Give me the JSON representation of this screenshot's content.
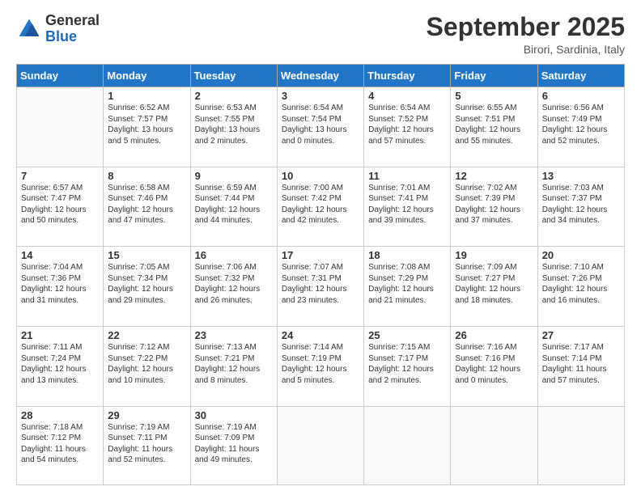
{
  "logo": {
    "general": "General",
    "blue": "Blue"
  },
  "header": {
    "month_year": "September 2025",
    "location": "Birori, Sardinia, Italy"
  },
  "days_of_week": [
    "Sunday",
    "Monday",
    "Tuesday",
    "Wednesday",
    "Thursday",
    "Friday",
    "Saturday"
  ],
  "weeks": [
    [
      {
        "day": "",
        "sunrise": "",
        "sunset": "",
        "daylight": ""
      },
      {
        "day": "1",
        "sunrise": "Sunrise: 6:52 AM",
        "sunset": "Sunset: 7:57 PM",
        "daylight": "Daylight: 13 hours and 5 minutes."
      },
      {
        "day": "2",
        "sunrise": "Sunrise: 6:53 AM",
        "sunset": "Sunset: 7:55 PM",
        "daylight": "Daylight: 13 hours and 2 minutes."
      },
      {
        "day": "3",
        "sunrise": "Sunrise: 6:54 AM",
        "sunset": "Sunset: 7:54 PM",
        "daylight": "Daylight: 13 hours and 0 minutes."
      },
      {
        "day": "4",
        "sunrise": "Sunrise: 6:54 AM",
        "sunset": "Sunset: 7:52 PM",
        "daylight": "Daylight: 12 hours and 57 minutes."
      },
      {
        "day": "5",
        "sunrise": "Sunrise: 6:55 AM",
        "sunset": "Sunset: 7:51 PM",
        "daylight": "Daylight: 12 hours and 55 minutes."
      },
      {
        "day": "6",
        "sunrise": "Sunrise: 6:56 AM",
        "sunset": "Sunset: 7:49 PM",
        "daylight": "Daylight: 12 hours and 52 minutes."
      }
    ],
    [
      {
        "day": "7",
        "sunrise": "Sunrise: 6:57 AM",
        "sunset": "Sunset: 7:47 PM",
        "daylight": "Daylight: 12 hours and 50 minutes."
      },
      {
        "day": "8",
        "sunrise": "Sunrise: 6:58 AM",
        "sunset": "Sunset: 7:46 PM",
        "daylight": "Daylight: 12 hours and 47 minutes."
      },
      {
        "day": "9",
        "sunrise": "Sunrise: 6:59 AM",
        "sunset": "Sunset: 7:44 PM",
        "daylight": "Daylight: 12 hours and 44 minutes."
      },
      {
        "day": "10",
        "sunrise": "Sunrise: 7:00 AM",
        "sunset": "Sunset: 7:42 PM",
        "daylight": "Daylight: 12 hours and 42 minutes."
      },
      {
        "day": "11",
        "sunrise": "Sunrise: 7:01 AM",
        "sunset": "Sunset: 7:41 PM",
        "daylight": "Daylight: 12 hours and 39 minutes."
      },
      {
        "day": "12",
        "sunrise": "Sunrise: 7:02 AM",
        "sunset": "Sunset: 7:39 PM",
        "daylight": "Daylight: 12 hours and 37 minutes."
      },
      {
        "day": "13",
        "sunrise": "Sunrise: 7:03 AM",
        "sunset": "Sunset: 7:37 PM",
        "daylight": "Daylight: 12 hours and 34 minutes."
      }
    ],
    [
      {
        "day": "14",
        "sunrise": "Sunrise: 7:04 AM",
        "sunset": "Sunset: 7:36 PM",
        "daylight": "Daylight: 12 hours and 31 minutes."
      },
      {
        "day": "15",
        "sunrise": "Sunrise: 7:05 AM",
        "sunset": "Sunset: 7:34 PM",
        "daylight": "Daylight: 12 hours and 29 minutes."
      },
      {
        "day": "16",
        "sunrise": "Sunrise: 7:06 AM",
        "sunset": "Sunset: 7:32 PM",
        "daylight": "Daylight: 12 hours and 26 minutes."
      },
      {
        "day": "17",
        "sunrise": "Sunrise: 7:07 AM",
        "sunset": "Sunset: 7:31 PM",
        "daylight": "Daylight: 12 hours and 23 minutes."
      },
      {
        "day": "18",
        "sunrise": "Sunrise: 7:08 AM",
        "sunset": "Sunset: 7:29 PM",
        "daylight": "Daylight: 12 hours and 21 minutes."
      },
      {
        "day": "19",
        "sunrise": "Sunrise: 7:09 AM",
        "sunset": "Sunset: 7:27 PM",
        "daylight": "Daylight: 12 hours and 18 minutes."
      },
      {
        "day": "20",
        "sunrise": "Sunrise: 7:10 AM",
        "sunset": "Sunset: 7:26 PM",
        "daylight": "Daylight: 12 hours and 16 minutes."
      }
    ],
    [
      {
        "day": "21",
        "sunrise": "Sunrise: 7:11 AM",
        "sunset": "Sunset: 7:24 PM",
        "daylight": "Daylight: 12 hours and 13 minutes."
      },
      {
        "day": "22",
        "sunrise": "Sunrise: 7:12 AM",
        "sunset": "Sunset: 7:22 PM",
        "daylight": "Daylight: 12 hours and 10 minutes."
      },
      {
        "day": "23",
        "sunrise": "Sunrise: 7:13 AM",
        "sunset": "Sunset: 7:21 PM",
        "daylight": "Daylight: 12 hours and 8 minutes."
      },
      {
        "day": "24",
        "sunrise": "Sunrise: 7:14 AM",
        "sunset": "Sunset: 7:19 PM",
        "daylight": "Daylight: 12 hours and 5 minutes."
      },
      {
        "day": "25",
        "sunrise": "Sunrise: 7:15 AM",
        "sunset": "Sunset: 7:17 PM",
        "daylight": "Daylight: 12 hours and 2 minutes."
      },
      {
        "day": "26",
        "sunrise": "Sunrise: 7:16 AM",
        "sunset": "Sunset: 7:16 PM",
        "daylight": "Daylight: 12 hours and 0 minutes."
      },
      {
        "day": "27",
        "sunrise": "Sunrise: 7:17 AM",
        "sunset": "Sunset: 7:14 PM",
        "daylight": "Daylight: 11 hours and 57 minutes."
      }
    ],
    [
      {
        "day": "28",
        "sunrise": "Sunrise: 7:18 AM",
        "sunset": "Sunset: 7:12 PM",
        "daylight": "Daylight: 11 hours and 54 minutes."
      },
      {
        "day": "29",
        "sunrise": "Sunrise: 7:19 AM",
        "sunset": "Sunset: 7:11 PM",
        "daylight": "Daylight: 11 hours and 52 minutes."
      },
      {
        "day": "30",
        "sunrise": "Sunrise: 7:19 AM",
        "sunset": "Sunset: 7:09 PM",
        "daylight": "Daylight: 11 hours and 49 minutes."
      },
      {
        "day": "",
        "sunrise": "",
        "sunset": "",
        "daylight": ""
      },
      {
        "day": "",
        "sunrise": "",
        "sunset": "",
        "daylight": ""
      },
      {
        "day": "",
        "sunrise": "",
        "sunset": "",
        "daylight": ""
      },
      {
        "day": "",
        "sunrise": "",
        "sunset": "",
        "daylight": ""
      }
    ]
  ]
}
